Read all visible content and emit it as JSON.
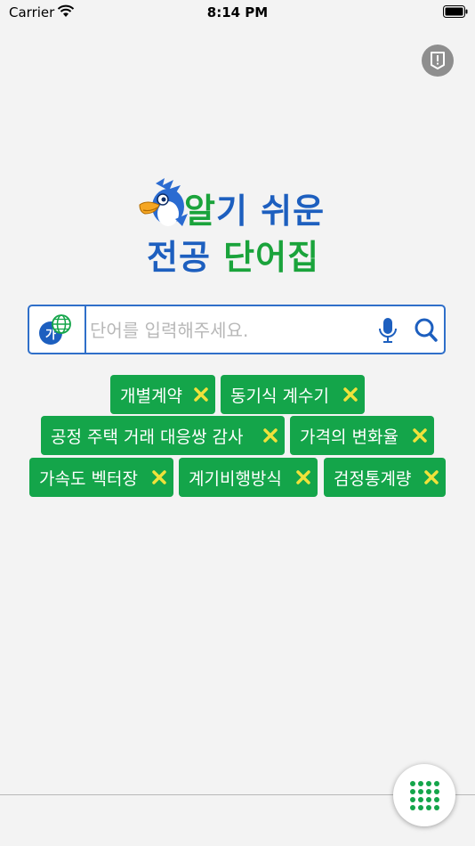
{
  "status_bar": {
    "carrier": "Carrier",
    "time": "8:14 PM"
  },
  "logo": {
    "line1_a": "알",
    "line1_b": "기 쉬운",
    "line2_a": "전공 ",
    "line2_b": "단어집"
  },
  "search": {
    "lang_label": "가",
    "placeholder": "단어를 입력해주세요.",
    "value": ""
  },
  "tags": [
    {
      "label": "개별계약"
    },
    {
      "label": "동기식 계수기"
    },
    {
      "label": "공정 주택 거래 대응쌍 감사"
    },
    {
      "label": "가격의 변화율"
    },
    {
      "label": "가속도 벡터장"
    },
    {
      "label": "계기비행방식"
    },
    {
      "label": "검정통계량"
    }
  ],
  "colors": {
    "accent": "#14a54a",
    "brand_blue": "#1d5fbf",
    "close_x": "#f0e23a"
  },
  "icons": [
    "wifi-icon",
    "battery-icon",
    "report-icon",
    "globe-icon",
    "mic-icon",
    "search-icon",
    "close-icon",
    "grid-menu-icon"
  ]
}
